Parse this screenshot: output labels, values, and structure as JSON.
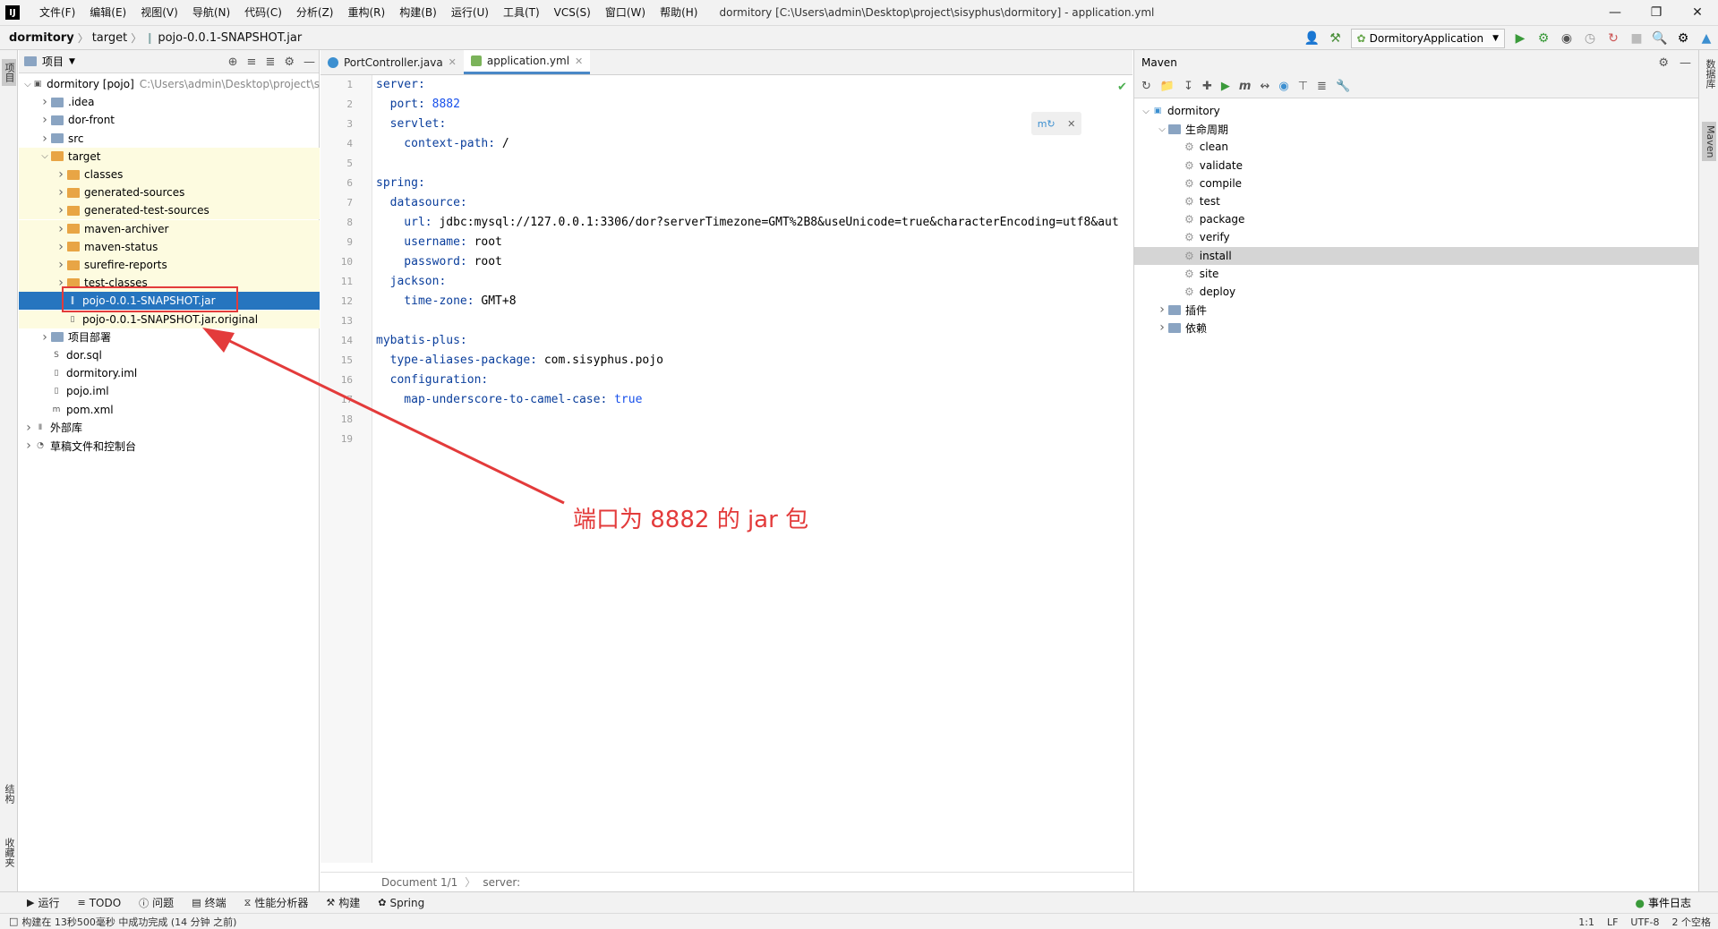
{
  "menubar": {
    "logo": "IJ",
    "items": [
      "文件(F)",
      "编辑(E)",
      "视图(V)",
      "导航(N)",
      "代码(C)",
      "分析(Z)",
      "重构(R)",
      "构建(B)",
      "运行(U)",
      "工具(T)",
      "VCS(S)",
      "窗口(W)",
      "帮助(H)"
    ],
    "window_title": "dormitory [C:\\Users\\admin\\Desktop\\project\\sisyphus\\dormitory] - application.yml"
  },
  "navbar": {
    "crumbs": [
      "dormitory",
      "target",
      "pojo-0.0.1-SNAPSHOT.jar"
    ],
    "run_config": "DormitoryApplication"
  },
  "left_stripe": {
    "project_tab": "项目",
    "structure_tab": "结构",
    "favorites_tab": "收藏夹"
  },
  "right_stripe": {
    "database_tab": "数据库",
    "maven_tab": "Maven"
  },
  "project": {
    "header": "项目",
    "tree": [
      {
        "label": "dormitory [pojo]",
        "extra": "C:\\Users\\admin\\Desktop\\project\\s",
        "indent": 0,
        "arrow": "open",
        "icon": "module"
      },
      {
        "label": ".idea",
        "indent": 1,
        "arrow": "closed",
        "icon": "folder-blue"
      },
      {
        "label": "dor-front",
        "indent": 1,
        "arrow": "closed",
        "icon": "folder-blue"
      },
      {
        "label": "src",
        "indent": 1,
        "arrow": "closed",
        "icon": "folder-blue"
      },
      {
        "label": "target",
        "indent": 1,
        "arrow": "open",
        "icon": "folder"
      },
      {
        "label": "classes",
        "indent": 2,
        "arrow": "closed",
        "icon": "folder"
      },
      {
        "label": "generated-sources",
        "indent": 2,
        "arrow": "closed",
        "icon": "folder"
      },
      {
        "label": "generated-test-sources",
        "indent": 2,
        "arrow": "closed",
        "icon": "folder"
      },
      {
        "label": "maven-archiver",
        "indent": 2,
        "arrow": "closed",
        "icon": "folder"
      },
      {
        "label": "maven-status",
        "indent": 2,
        "arrow": "closed",
        "icon": "folder"
      },
      {
        "label": "surefire-reports",
        "indent": 2,
        "arrow": "closed",
        "icon": "folder"
      },
      {
        "label": "test-classes",
        "indent": 2,
        "arrow": "closed",
        "icon": "folder"
      },
      {
        "label": "pojo-0.0.1-SNAPSHOT.jar",
        "indent": 2,
        "arrow": "",
        "icon": "jar",
        "selected": true
      },
      {
        "label": "pojo-0.0.1-SNAPSHOT.jar.original",
        "indent": 2,
        "arrow": "",
        "icon": "file"
      },
      {
        "label": "项目部署",
        "indent": 1,
        "arrow": "closed",
        "icon": "folder-blue"
      },
      {
        "label": "dor.sql",
        "indent": 1,
        "arrow": "",
        "icon": "sql"
      },
      {
        "label": "dormitory.iml",
        "indent": 1,
        "arrow": "",
        "icon": "file"
      },
      {
        "label": "pojo.iml",
        "indent": 1,
        "arrow": "",
        "icon": "file"
      },
      {
        "label": "pom.xml",
        "indent": 1,
        "arrow": "",
        "icon": "maven"
      },
      {
        "label": "外部库",
        "indent": 0,
        "arrow": "closed",
        "icon": "lib"
      },
      {
        "label": "草稿文件和控制台",
        "indent": 0,
        "arrow": "closed",
        "icon": "scratch"
      }
    ]
  },
  "editor": {
    "tabs": [
      {
        "label": "PortController.java",
        "active": false
      },
      {
        "label": "application.yml",
        "active": true
      }
    ],
    "lines": [
      [
        {
          "t": "k",
          "s": "server:"
        }
      ],
      [
        {
          "t": "k",
          "s": "  port: "
        },
        {
          "t": "n",
          "s": "8882"
        }
      ],
      [
        {
          "t": "k",
          "s": "  servlet:"
        }
      ],
      [
        {
          "t": "k",
          "s": "    context-path: "
        },
        {
          "t": "v",
          "s": "/"
        }
      ],
      [],
      [
        {
          "t": "k",
          "s": "spring:"
        }
      ],
      [
        {
          "t": "k",
          "s": "  datasource:"
        }
      ],
      [
        {
          "t": "k",
          "s": "    url: "
        },
        {
          "t": "v",
          "s": "jdbc:mysql://127.0.0.1:3306/dor?serverTimezone=GMT%2B8&useUnicode=true&characterEncoding=utf8&aut"
        }
      ],
      [
        {
          "t": "k",
          "s": "    username: "
        },
        {
          "t": "v",
          "s": "root"
        }
      ],
      [
        {
          "t": "k",
          "s": "    password: "
        },
        {
          "t": "v",
          "s": "root"
        }
      ],
      [
        {
          "t": "k",
          "s": "  jackson:"
        }
      ],
      [
        {
          "t": "k",
          "s": "    time-zone: "
        },
        {
          "t": "v",
          "s": "GMT+8"
        }
      ],
      [],
      [
        {
          "t": "k",
          "s": "mybatis-plus:"
        }
      ],
      [
        {
          "t": "k",
          "s": "  type-aliases-package: "
        },
        {
          "t": "v",
          "s": "com.sisyphus.pojo"
        }
      ],
      [
        {
          "t": "k",
          "s": "  configuration:"
        }
      ],
      [
        {
          "t": "k",
          "s": "    map-underscore-to-camel-case: "
        },
        {
          "t": "n",
          "s": "true"
        }
      ],
      [],
      []
    ],
    "breadcrumb": [
      "Document 1/1",
      "server:"
    ]
  },
  "maven": {
    "title": "Maven",
    "tree": [
      {
        "label": "dormitory",
        "indent": 0,
        "arrow": "open",
        "icon": "module"
      },
      {
        "label": "生命周期",
        "indent": 1,
        "arrow": "open",
        "icon": "folder"
      },
      {
        "label": "clean",
        "indent": 2,
        "icon": "gear"
      },
      {
        "label": "validate",
        "indent": 2,
        "icon": "gear"
      },
      {
        "label": "compile",
        "indent": 2,
        "icon": "gear"
      },
      {
        "label": "test",
        "indent": 2,
        "icon": "gear"
      },
      {
        "label": "package",
        "indent": 2,
        "icon": "gear"
      },
      {
        "label": "verify",
        "indent": 2,
        "icon": "gear"
      },
      {
        "label": "install",
        "indent": 2,
        "icon": "gear",
        "selected": true
      },
      {
        "label": "site",
        "indent": 2,
        "icon": "gear"
      },
      {
        "label": "deploy",
        "indent": 2,
        "icon": "gear"
      },
      {
        "label": "插件",
        "indent": 1,
        "arrow": "closed",
        "icon": "folder"
      },
      {
        "label": "依赖",
        "indent": 1,
        "arrow": "closed",
        "icon": "folder"
      }
    ]
  },
  "bottom_tools": [
    "运行",
    "TODO",
    "问题",
    "终端",
    "性能分析器",
    "构建",
    "Spring"
  ],
  "event_log": "事件日志",
  "status": {
    "message": "构建在 13秒500毫秒 中成功完成 (14 分钟 之前)",
    "position": "1:1",
    "line_sep": "LF",
    "encoding": "UTF-8",
    "indent": "2 个空格"
  },
  "annotation": {
    "text": "端口为 8882 的 jar 包",
    "color": "#e33b3b"
  }
}
